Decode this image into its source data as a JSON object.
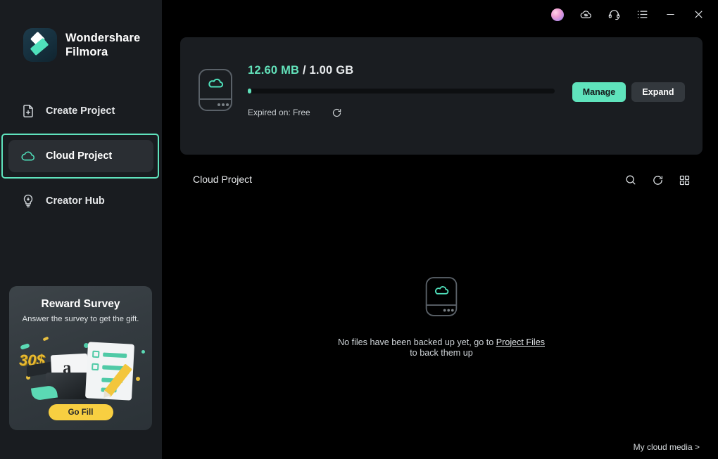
{
  "app": {
    "brand_line1": "Wondershare",
    "brand_line2": "Filmora"
  },
  "sidebar": {
    "items": [
      {
        "label": "Create Project",
        "icon": "file-plus-icon",
        "active": false
      },
      {
        "label": "Cloud Project",
        "icon": "cloud-icon",
        "active": true
      },
      {
        "label": "Creator Hub",
        "icon": "lightbulb-icon",
        "active": false
      }
    ],
    "promo": {
      "title": "Reward Survey",
      "subtitle": "Answer the survey to get the gift.",
      "button_label": "Go Fill",
      "art_amount": "30$",
      "art_card_letter": "a"
    }
  },
  "header": {
    "icons": [
      {
        "name": "user-avatar",
        "glyph": ""
      },
      {
        "name": "cloud-sync-icon",
        "glyph": ""
      },
      {
        "name": "headset-support-icon",
        "glyph": ""
      },
      {
        "name": "menu-list-icon",
        "glyph": ""
      },
      {
        "name": "minimize-icon",
        "glyph": ""
      },
      {
        "name": "close-icon",
        "glyph": ""
      }
    ]
  },
  "storage": {
    "used": "12.60 MB",
    "total": "/ 1.00 GB",
    "percent_used": 1.23,
    "expired_label": "Expired on: Free",
    "manage_label": "Manage",
    "expand_label": "Expand",
    "accent_color": "#5fe3bc",
    "bar_track_color": "#0d0f11"
  },
  "section": {
    "title": "Cloud Project",
    "tools": [
      {
        "name": "search-icon"
      },
      {
        "name": "refresh-icon"
      },
      {
        "name": "grid-view-icon"
      }
    ]
  },
  "empty_state": {
    "line1_prefix": "No files have been backed up yet, go to ",
    "link_label": "Project Files",
    "line2": "to back them up"
  },
  "footer": {
    "link_label": "My cloud media >"
  }
}
